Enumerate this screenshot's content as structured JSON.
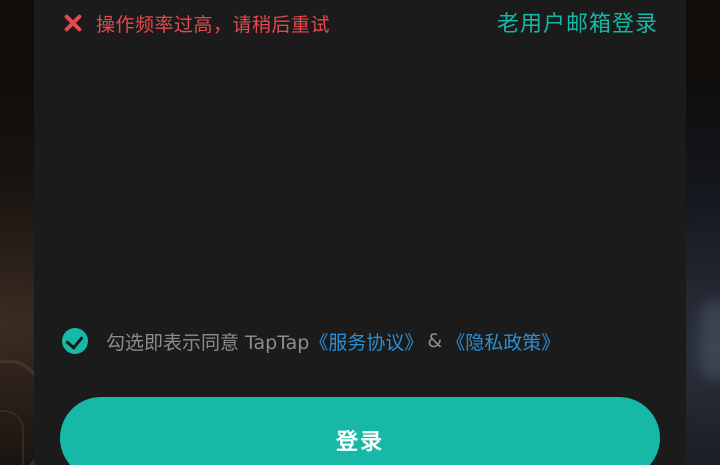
{
  "error": {
    "icon": "close-x-icon",
    "message": "操作频率过高，请稍后重试",
    "color": "#e5484d"
  },
  "header": {
    "email_login_link": "老用户邮箱登录"
  },
  "agreement": {
    "checked": true,
    "prefix": "勾选即表示同意 TapTap",
    "service_link": "《服务协议》",
    "amp": "&",
    "privacy_link": "《隐私政策》"
  },
  "login_button": {
    "label": "登录"
  },
  "colors": {
    "accent": "#17b8a6",
    "panel": "#1b1b1b",
    "link_blue": "#2b8fd6",
    "muted_text": "#8c8c8c"
  }
}
